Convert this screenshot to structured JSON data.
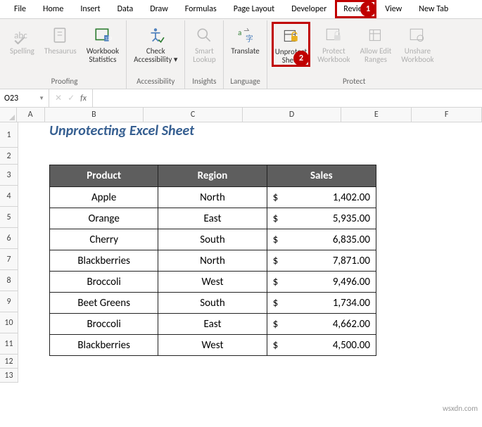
{
  "tabs": [
    "File",
    "Home",
    "Insert",
    "Data",
    "Draw",
    "Formulas",
    "Page Layout",
    "Developer",
    "Review",
    "View",
    "New Tab"
  ],
  "highlighted_tab_index": 8,
  "callouts": {
    "one": "1",
    "two": "2"
  },
  "ribbon": {
    "proofing": {
      "label": "Proofing",
      "spelling": "Spelling",
      "thesaurus": "Thesaurus",
      "workbook_stats": "Workbook\nStatistics"
    },
    "accessibility": {
      "label": "Accessibility",
      "check": "Check\nAccessibility"
    },
    "insights": {
      "label": "Insights",
      "smart_lookup": "Smart\nLookup"
    },
    "language": {
      "label": "Language",
      "translate": "Translate"
    },
    "protect": {
      "label": "Protect",
      "unprotect_sheet": "Unprotect\nSheet",
      "protect_workbook": "Protect\nWorkbook",
      "allow_edit_ranges": "Allow Edit\nRanges",
      "unshare_workbook": "Unshare\nWorkbook"
    }
  },
  "formula_bar": {
    "name_box": "O23",
    "fx": "fx"
  },
  "columns": [
    "A",
    "B",
    "C",
    "D",
    "E",
    "F"
  ],
  "rows": [
    "1",
    "2",
    "3",
    "4",
    "5",
    "6",
    "7",
    "8",
    "9",
    "10",
    "11",
    "12",
    "13"
  ],
  "sheet_title": "Unprotecting Excel Sheet",
  "table": {
    "headers": {
      "product": "Product",
      "region": "Region",
      "sales": "Sales"
    },
    "rows": [
      {
        "product": "Apple",
        "region": "North",
        "currency": "$",
        "sales": "1,402.00"
      },
      {
        "product": "Orange",
        "region": "East",
        "currency": "$",
        "sales": "5,935.00"
      },
      {
        "product": "Cherry",
        "region": "South",
        "currency": "$",
        "sales": "6,835.00"
      },
      {
        "product": "Blackberries",
        "region": "North",
        "currency": "$",
        "sales": "7,871.00"
      },
      {
        "product": "Broccoli",
        "region": "West",
        "currency": "$",
        "sales": "9,496.00"
      },
      {
        "product": "Beet Greens",
        "region": "South",
        "currency": "$",
        "sales": "1,734.00"
      },
      {
        "product": "Broccoli",
        "region": "East",
        "currency": "$",
        "sales": "4,662.00"
      },
      {
        "product": "Blackberries",
        "region": "West",
        "currency": "$",
        "sales": "4,500.00"
      }
    ]
  },
  "watermark": "wsxdn.com"
}
